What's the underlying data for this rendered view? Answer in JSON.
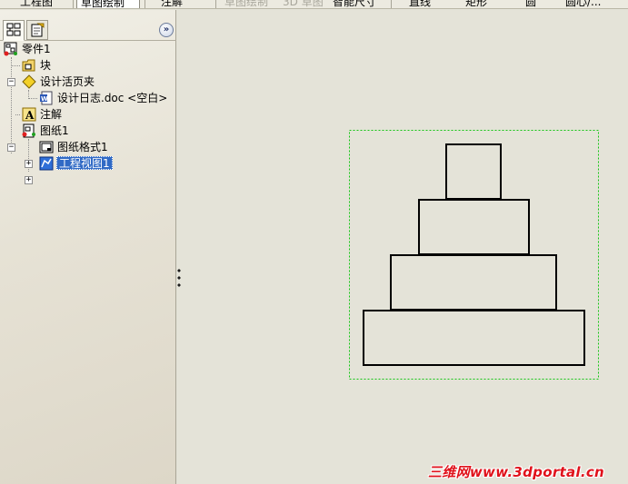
{
  "toolbar": {
    "items": [
      {
        "label": "工程图",
        "state": "normal"
      },
      {
        "label": "草图绘制",
        "state": "pressed"
      },
      {
        "label": "注解",
        "state": "normal"
      },
      {
        "label": "草图绘制",
        "state": "disabled"
      },
      {
        "label": "3D 草图",
        "state": "disabled"
      },
      {
        "label": "智能尺寸",
        "state": "normal"
      },
      {
        "label": "直线",
        "state": "normal"
      },
      {
        "label": "矩形",
        "state": "normal"
      },
      {
        "label": "圆",
        "state": "normal"
      },
      {
        "label": "圆心/...",
        "state": "normal"
      }
    ]
  },
  "panel": {
    "tabs": [
      {
        "name": "featuremanager-tab",
        "icon": "feature-tree-icon",
        "active": true
      },
      {
        "name": "propertymanager-tab",
        "icon": "property-icon",
        "active": false
      }
    ],
    "collapse_label": "»"
  },
  "tree": {
    "root": {
      "label": "零件1",
      "icon": "drawing-document-icon"
    },
    "items": [
      {
        "label": "块",
        "icon": "block-folder-icon"
      },
      {
        "label": "设计活页夹",
        "icon": "design-binder-icon",
        "expanded": true
      },
      {
        "label": "设计日志.doc <空白>",
        "icon": "word-document-icon"
      },
      {
        "label": "注解",
        "icon": "annotation-icon"
      },
      {
        "label": "图纸1",
        "icon": "sheet-icon",
        "expanded": true
      },
      {
        "label": "图纸格式1",
        "icon": "sheet-format-icon",
        "expanded": false
      },
      {
        "label": "工程视图1",
        "icon": "drawing-view-icon",
        "expanded": false,
        "selected": true
      }
    ]
  },
  "drawing": {
    "view_border_color": "#14c414",
    "line_color": "#000000",
    "tiers": [
      "top-block",
      "second-block",
      "third-block",
      "base-block"
    ]
  },
  "colors": {
    "selection": "#316ac5",
    "canvas_bg": "#e4e3d8",
    "watermark": "#e0121b"
  },
  "watermark": {
    "text": "三维网www.3dportal.cn"
  }
}
